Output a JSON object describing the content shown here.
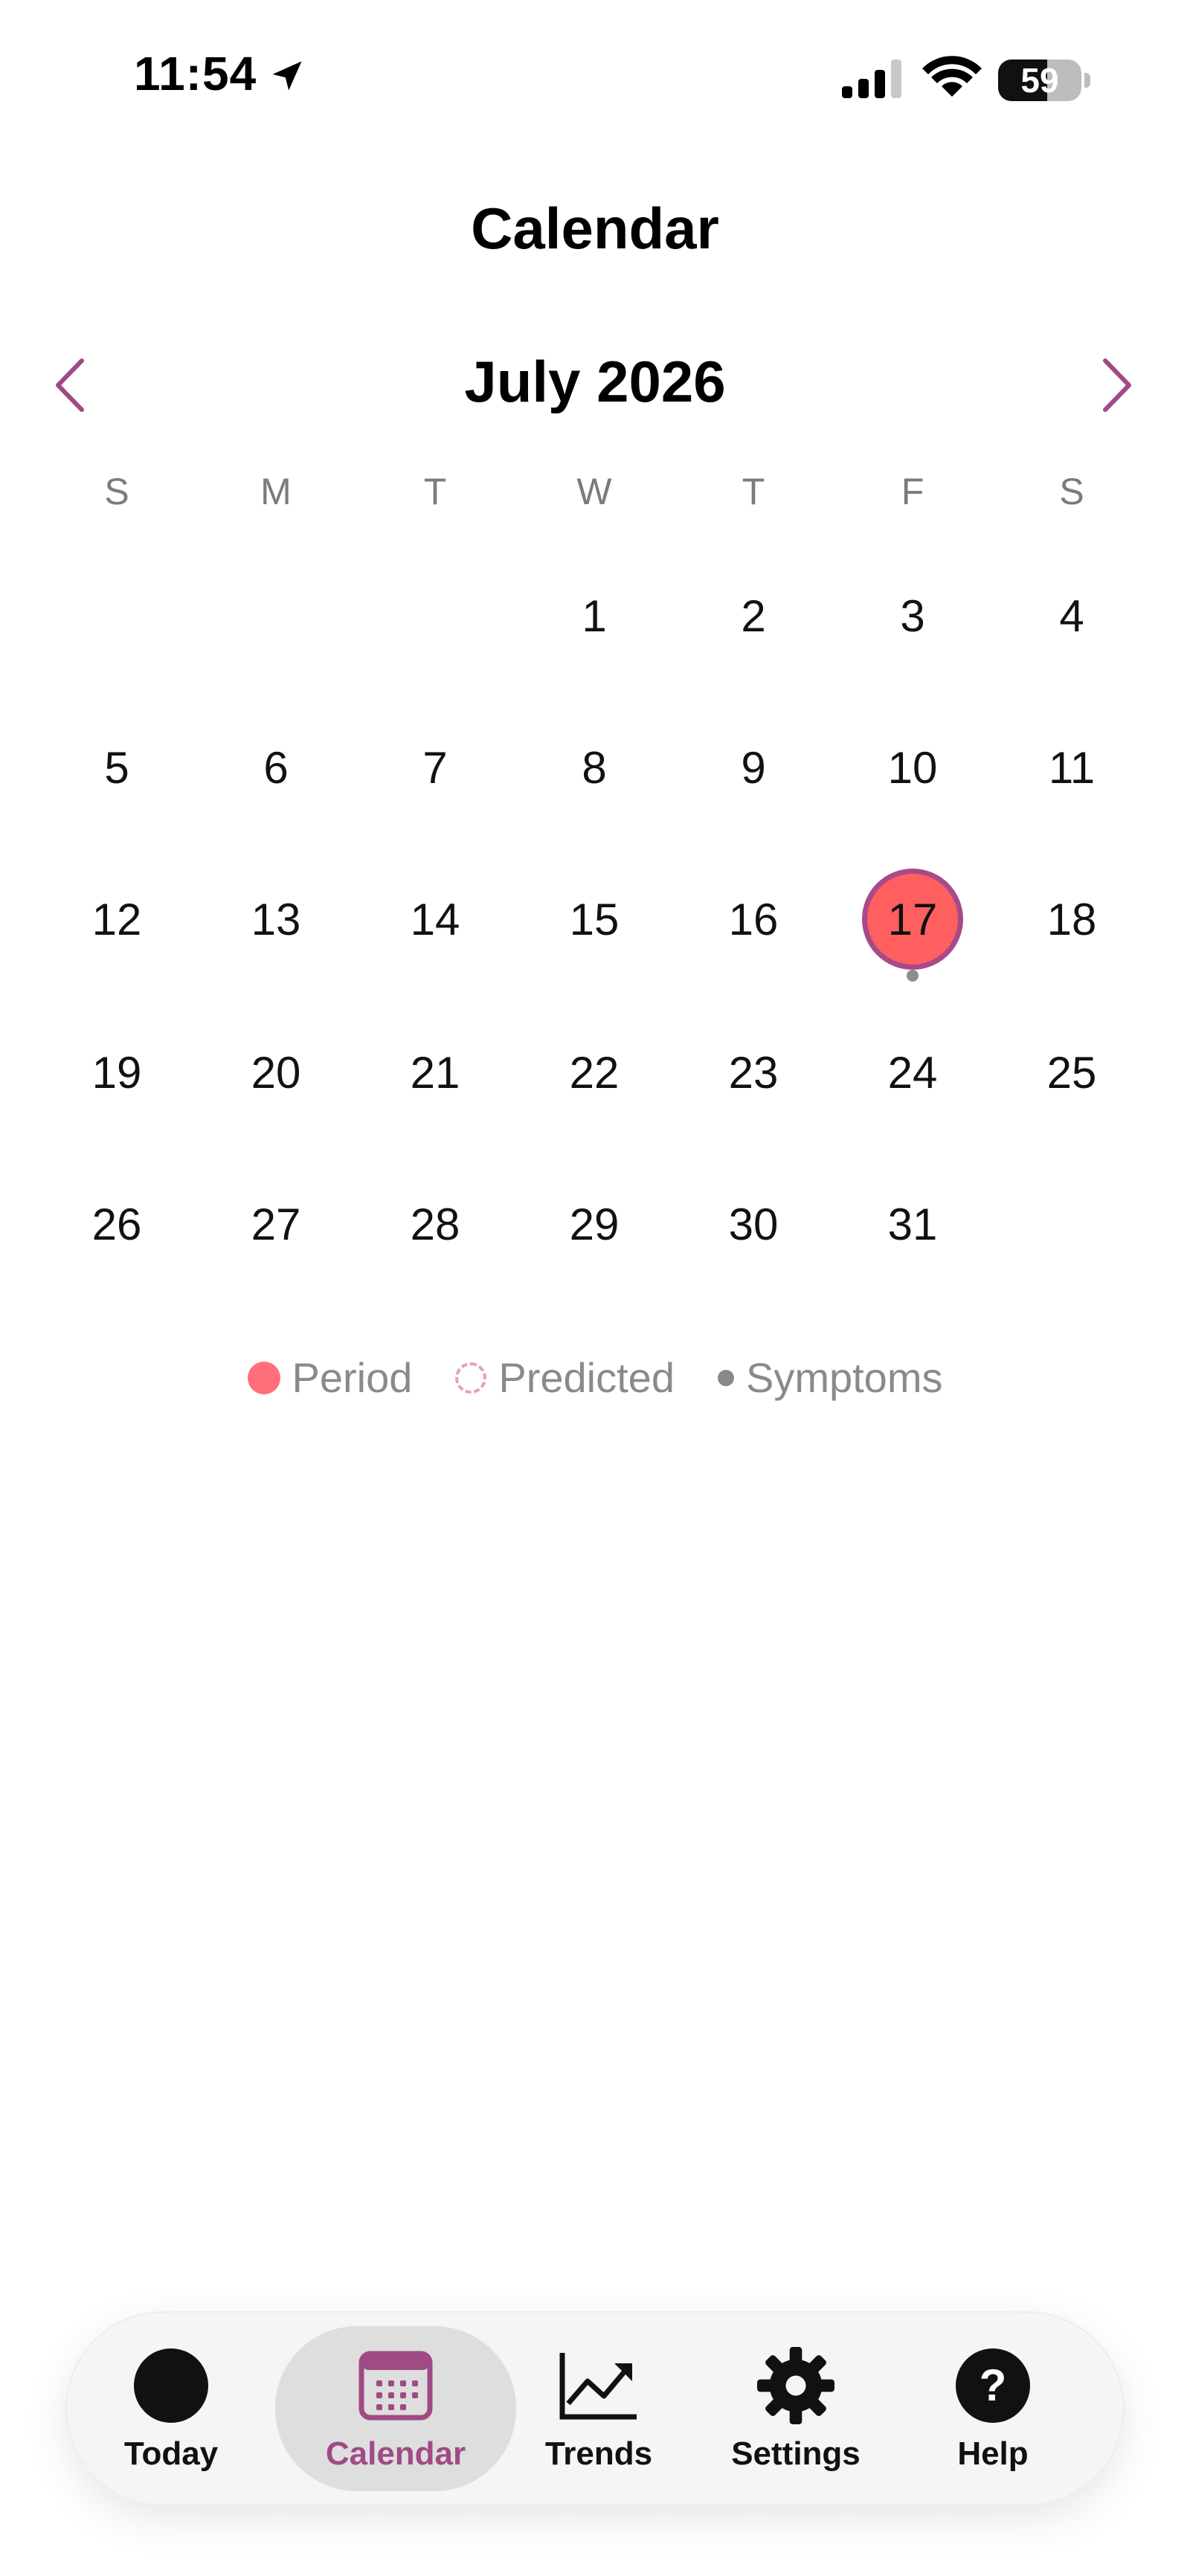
{
  "status_bar": {
    "time": "11:54",
    "battery_percent": "59",
    "battery_level": 0.59,
    "icons": [
      "location-arrow-icon",
      "cellular-signal-icon",
      "wifi-icon",
      "battery-icon"
    ]
  },
  "header": {
    "title": "Calendar",
    "month": "July 2026",
    "prev_icon": "chevron-left-icon",
    "next_icon": "chevron-right-icon"
  },
  "calendar": {
    "weekdays": [
      "S",
      "M",
      "T",
      "W",
      "T",
      "F",
      "S"
    ],
    "weeks": [
      [
        "",
        "",
        "",
        "1",
        "2",
        "3",
        "4"
      ],
      [
        "5",
        "6",
        "7",
        "8",
        "9",
        "10",
        "11"
      ],
      [
        "12",
        "13",
        "14",
        "15",
        "16",
        "17",
        "18"
      ],
      [
        "19",
        "20",
        "21",
        "22",
        "23",
        "24",
        "25"
      ],
      [
        "26",
        "27",
        "28",
        "29",
        "30",
        "31",
        ""
      ]
    ],
    "selected_day": "17",
    "symptom_days": [
      "17"
    ]
  },
  "legend": {
    "period": "Period",
    "predicted": "Predicted",
    "symptoms": "Symptoms"
  },
  "tabbar": {
    "tabs": [
      {
        "label": "Today",
        "icon": "circle-icon"
      },
      {
        "label": "Calendar",
        "icon": "calendar-icon"
      },
      {
        "label": "Trends",
        "icon": "trend-chart-icon"
      },
      {
        "label": "Settings",
        "icon": "gear-icon"
      },
      {
        "label": "Help",
        "icon": "question-icon"
      }
    ],
    "active": "Calendar"
  },
  "colors": {
    "accent": "#a04a86",
    "period": "#ff5f5f",
    "legend_period": "#ff6f7a",
    "predicted_border": "#e8a0b0",
    "symptom_dot": "#8d8d8d"
  }
}
